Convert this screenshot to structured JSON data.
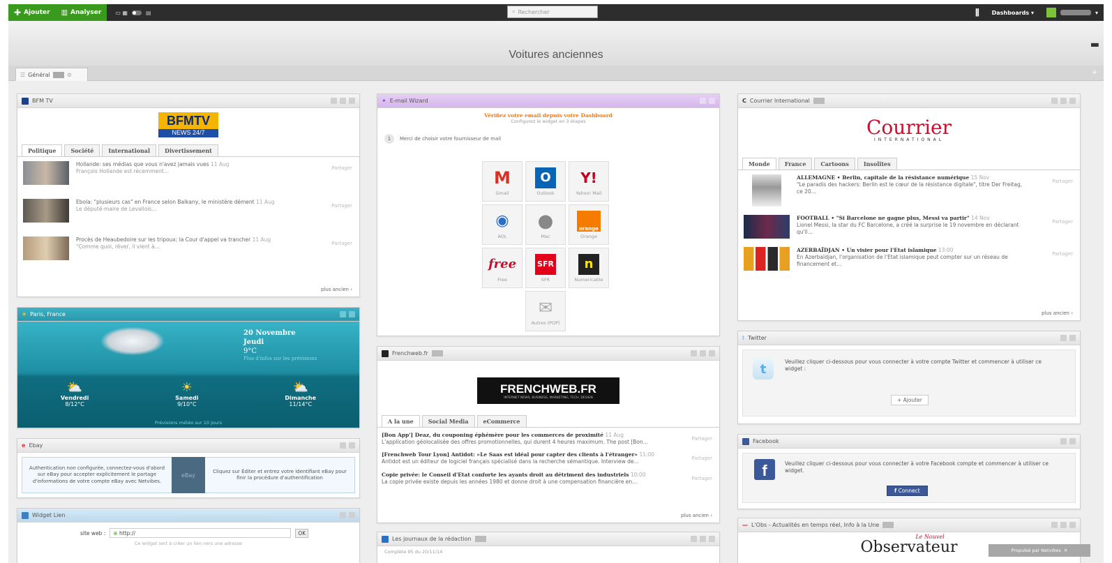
{
  "topbar": {
    "add_label": "Ajouter",
    "analyze_label": "Analyser",
    "search_placeholder": "Rechercher",
    "dashboards_label": "Dashboards"
  },
  "page": {
    "title": "Voitures anciennes",
    "tab_general": "Général"
  },
  "bfm": {
    "title": "BFM TV",
    "logo_top": "BFMTV",
    "logo_bottom": "NEWS 24/7",
    "tabs": [
      "Politique",
      "Société",
      "International",
      "Divertissement"
    ],
    "items": [
      {
        "headline": "Hollande: ses médias que vous n'avez jamais vues",
        "date": "11 Aug",
        "sub": "François Hollande est récemment..."
      },
      {
        "headline": "Ebola: \"plusieurs cas\" en France selon Balkany, le ministère dément",
        "date": "11 Aug",
        "sub": "Le député-maire de Levallois..."
      },
      {
        "headline": "Procès de Heaubedoire sur les tripoux: la Cour d'appel va trancher",
        "date": "11 Aug",
        "sub": "\"Comme quoi, rêver, il vient à..."
      }
    ],
    "share": "Partager",
    "more": "plus ancien"
  },
  "weather": {
    "title": "Paris, France",
    "date": "20 Novembre",
    "day": "Jeudi",
    "temp": "9°C",
    "link": "Plus d'infos sur les prévisions",
    "forecast": [
      {
        "day": "Vendredi",
        "temp": "8/12°C"
      },
      {
        "day": "Samedi",
        "temp": "9/10°C"
      },
      {
        "day": "Dimanche",
        "temp": "11/14°C"
      }
    ],
    "footer": "Prévisions météo sur 10 jours"
  },
  "ebay": {
    "title": "Ebay",
    "auth_text": "Authentication non configurée, connectez-vous d'abord sur eBay pour accepter explicitement le partage d'informations de votre compte eBay avec Netvibes.",
    "right_text": "Cliquez sur Éditer et entrez votre identifiant eBay pour finir la procédure d'authentification",
    "logo": "eBay"
  },
  "widget_lien": {
    "title": "Widget Lien",
    "label": "site web :",
    "value": "http://",
    "ok": "OK",
    "hint": "Ce widget sert à créer un lien vers une adresse"
  },
  "mail": {
    "title": "E-mail Wizard",
    "heading": "Vérifiez votre email depuis votre Dashboard",
    "subheading": "Configurez le widget en 3 étapes",
    "step_num": "1",
    "step_text": "Merci de choisir votre fournisseur de mail",
    "providers": [
      {
        "name": "Gmail",
        "glyph": "M",
        "color": "#d93025"
      },
      {
        "name": "Outlook",
        "glyph": "O",
        "color": "#0a64b4"
      },
      {
        "name": "Yahoo! Mail",
        "glyph": "Y!",
        "color": "#c4001e"
      },
      {
        "name": "AOL",
        "glyph": "◄",
        "color": "#2a6ec8"
      },
      {
        "name": "Mac",
        "glyph": "●",
        "color": "#888888"
      },
      {
        "name": "Orange",
        "glyph": "orange",
        "color": "#f57c00"
      },
      {
        "name": "Free",
        "glyph": "free",
        "color": "#c8102e"
      },
      {
        "name": "SFR",
        "glyph": "SFR",
        "color": "#e2001a"
      },
      {
        "name": "Numericable",
        "glyph": "n",
        "color": "#222222"
      },
      {
        "name": "Autres (POP)",
        "glyph": "✉",
        "color": "#999999"
      }
    ]
  },
  "frenchweb": {
    "title": "Frenchweb.fr",
    "logo": "FRENCHWEB.FR",
    "logo_sub": "INTERNET NEWS, BUSINESS, MARKETING, TECH, DESIGN",
    "tabs": [
      "A la une",
      "Social Media",
      "eCommerce"
    ],
    "items": [
      {
        "headline": "[Bon App'] Deaz, du couponing éphémère pour les commerces de proximité",
        "date": "11 Aug",
        "sub": "L'application géolocalisée des offres promotionnelles, qui durent 4 heures maximum. The post [Bon..."
      },
      {
        "headline": "[Frenchweb Tour Lyon] Antidot: «Le Saas est idéal pour capter des clients à l'étranger»",
        "date": "11:00",
        "sub": "Antidot est un éditeur de logiciel français spécialisé dans la recherche sémantique. Interview de..."
      },
      {
        "headline": "Copie privée: le Conseil d'Etat conforte les ayants droit au détriment des industriels",
        "date": "10:00",
        "sub": "La copie privée existe depuis les années 1980 et donne droit à une compensation financière en..."
      }
    ],
    "share": "Partager",
    "more": "plus ancien"
  },
  "journaux": {
    "title": "Les journaux de la rédaction",
    "item": "Complète 95 du 20/11/14"
  },
  "courrier": {
    "title": "Courrier International",
    "logo": "Courrier",
    "logo_sub": "INTERNATIONAL",
    "tabs": [
      "Monde",
      "France",
      "Cartoons",
      "Insolites"
    ],
    "items": [
      {
        "headline": "ALLEMAGNE • Berlin, capitale de la résistance numérique",
        "date": "15 Nov",
        "sub": "\"Le paradis des hackers: Berlin est le cœur de la résistance digitale\", titre Der Freitag, ce 20..."
      },
      {
        "headline": "FOOTBALL • \"Si Barcelone ne gagne plus, Messi va partir\"",
        "date": "14 Nov",
        "sub": "Lionel Messi, la star du FC Barcelone, a créé la surprise le 19 novembre en déclarant qu'il..."
      },
      {
        "headline": "AZERBAÏDJAN • Un visier pour l'Etat islamique",
        "date": "13:00",
        "sub": "En Azerbaïdjan, l'organisation de l'Etat islamique peut compter sur un réseau de financement et..."
      }
    ],
    "share": "Partager",
    "more": "plus ancien"
  },
  "twitter": {
    "title": "Twitter",
    "text": "Veuillez cliquer ci-dessous pour vous connecter à votre compte Twitter et commencer à utiliser ce widget :",
    "button": "+ Ajouter"
  },
  "facebook": {
    "title": "Facebook",
    "text": "Veuillez cliquer ci-dessous pour vous connecter à votre Facebook compte et commencer à utiliser ce widget.",
    "button": "Connect"
  },
  "obs": {
    "title": "L'Obs - Actualités en temps réel, Info à la Une",
    "logo_top": "Le Nouvel",
    "logo": "Observateur"
  },
  "powered": "Propulsé par Netvibes"
}
